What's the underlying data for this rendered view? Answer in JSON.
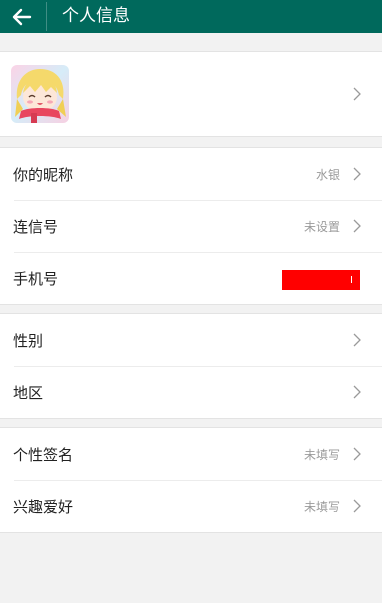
{
  "header": {
    "title": "个人信息",
    "background": "#00695c"
  },
  "profile": {
    "avatar_label": "avatar"
  },
  "rows": {
    "nickname": {
      "label": "你的昵称",
      "value": "水银"
    },
    "lianxin_id": {
      "label": "连信号",
      "value": "未设置"
    },
    "phone": {
      "label": "手机号",
      "value": ""
    },
    "gender": {
      "label": "性别",
      "value": ""
    },
    "region": {
      "label": "地区",
      "value": ""
    },
    "signature": {
      "label": "个性签名",
      "value": "未填写"
    },
    "hobbies": {
      "label": "兴趣爱好",
      "value": "未填写"
    }
  },
  "colors": {
    "label_text": "#222222",
    "value_text": "#9a9a9a",
    "redaction": "#ff0000"
  }
}
